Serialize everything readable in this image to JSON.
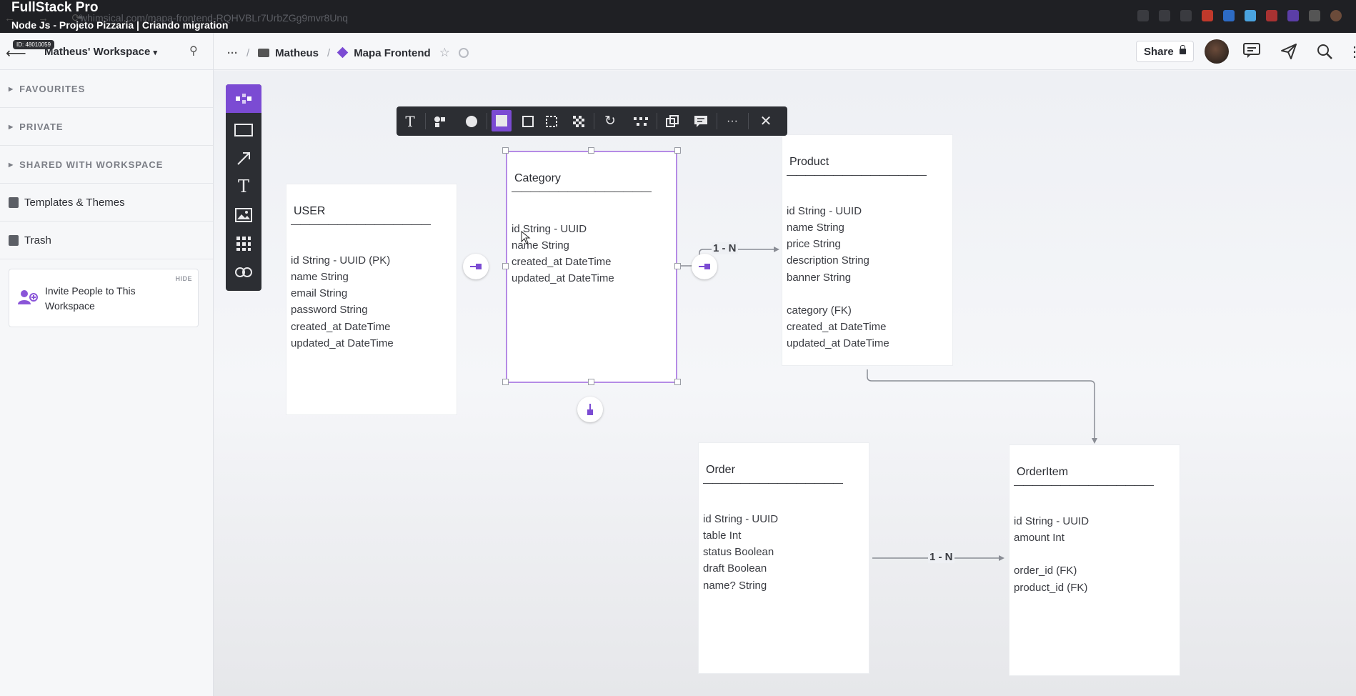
{
  "overlay": {
    "channel_title": "FullStack Pro",
    "video_title": "Node Js - Projeto Pizzaria | Criando migration"
  },
  "browser": {
    "url": "whimsical.com/mapa-frontend-RQHVBLr7UrbZGg9mvr8Unq"
  },
  "header": {
    "id_badge": "ID: 48010059",
    "workspace_name": "Matheus' Workspace",
    "breadcrumbs": [
      {
        "label": "Matheus",
        "icon": "folder-icon"
      },
      {
        "label": "Mapa Frontend",
        "icon": "diamond-icon"
      }
    ],
    "ellipsis": "···",
    "separator": "/",
    "share_label": "Share"
  },
  "sidebar": {
    "sections": [
      {
        "label": "FAVOURITES"
      },
      {
        "label": "PRIVATE"
      },
      {
        "label": "SHARED WITH WORKSPACE"
      }
    ],
    "links": [
      {
        "label": "Templates & Themes",
        "icon": "template-icon"
      },
      {
        "label": "Trash",
        "icon": "trash-icon"
      }
    ],
    "invite": {
      "text": "Invite People to This Workspace",
      "hide_label": "HIDE"
    }
  },
  "canvas": {
    "rule": "———————————————",
    "relation_label": "1 - N",
    "tables": {
      "user": {
        "title": "USER",
        "fields": [
          "id String - UUID (PK)",
          "name String",
          "email String",
          "password String",
          "created_at DateTime",
          "updated_at DateTime"
        ]
      },
      "category": {
        "title": "Category",
        "fields": [
          "id String - UUID",
          "name String",
          "created_at DateTime",
          "updated_at DateTime"
        ]
      },
      "product": {
        "title": "Product",
        "fields": [
          "id String - UUID",
          "name String",
          "price String",
          "description String",
          "banner String",
          "",
          "category (FK)",
          "created_at DateTime",
          "updated_at DateTime"
        ]
      },
      "order": {
        "title": "Order",
        "fields": [
          "id String - UUID",
          "table Int",
          "status Boolean",
          "draft Boolean",
          "name? String"
        ]
      },
      "orderitem": {
        "title": "OrderItem",
        "fields": [
          "id String - UUID",
          "amount Int",
          "",
          "order_id (FK)",
          "product_id (FK)"
        ]
      }
    }
  },
  "colors": {
    "accent": "#7b4bd3",
    "toolbar_bg": "#2c2e33"
  }
}
